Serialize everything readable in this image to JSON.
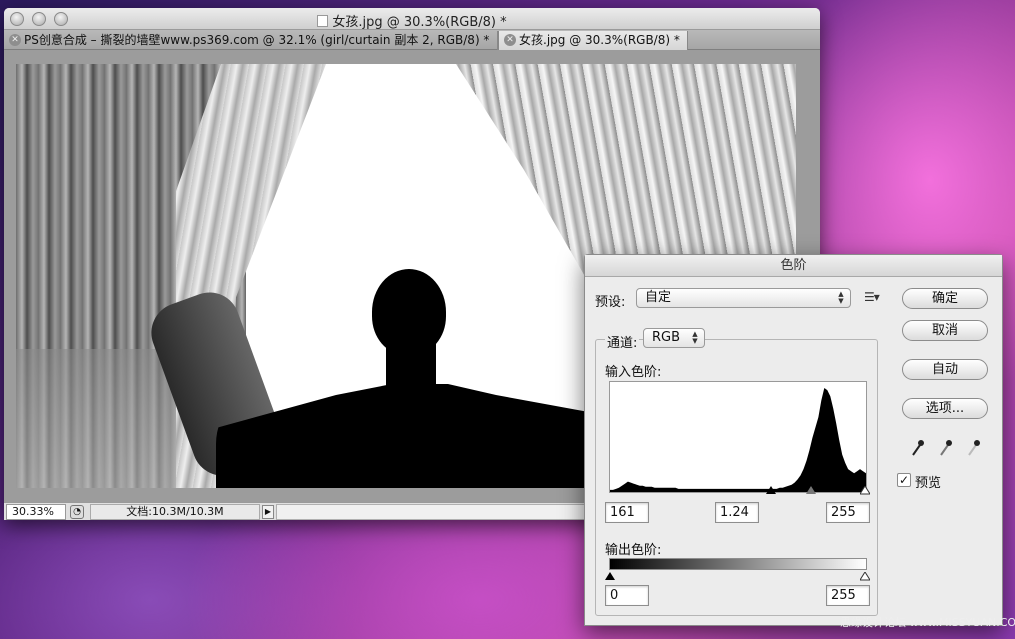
{
  "document_window": {
    "title": "女孩.jpg @ 30.3%(RGB/8) *",
    "tabs": [
      {
        "label": "PS创意合成 – 撕裂的墙壁www.ps369.com @ 32.1% (girl/curtain 副本 2, RGB/8) *",
        "active": false
      },
      {
        "label": "女孩.jpg @ 30.3%(RGB/8) *",
        "active": true
      }
    ],
    "status": {
      "zoom": "30.33%",
      "doc_size": "文档:10.3M/10.3M"
    }
  },
  "levels_dialog": {
    "title": "色阶",
    "preset_label": "预设:",
    "preset_value": "自定",
    "channel_label": "通道:",
    "channel_value": "RGB",
    "input_levels_label": "输入色阶:",
    "input_black": "161",
    "input_gamma": "1.24",
    "input_white": "255",
    "output_levels_label": "输出色阶:",
    "output_black": "0",
    "output_white": "255",
    "buttons": {
      "ok": "确定",
      "cancel": "取消",
      "auto": "自动",
      "options": "选项..."
    },
    "preview_label": "预览",
    "preview_checked": true,
    "histogram": [
      2,
      2,
      3,
      4,
      6,
      8,
      10,
      9,
      8,
      7,
      6,
      6,
      5,
      5,
      5,
      4,
      4,
      4,
      4,
      4,
      4,
      4,
      4,
      3,
      3,
      3,
      3,
      3,
      3,
      3,
      3,
      3,
      3,
      3,
      3,
      3,
      3,
      3,
      3,
      3,
      3,
      3,
      3,
      3,
      3,
      3,
      3,
      3,
      3,
      3,
      3,
      3,
      3,
      3,
      3,
      3,
      3,
      4,
      4,
      5,
      6,
      7,
      9,
      12,
      16,
      22,
      30,
      40,
      52,
      62,
      72,
      88,
      100,
      98,
      92,
      80,
      66,
      50,
      36,
      28,
      22,
      20,
      18,
      20,
      22,
      20,
      18
    ]
  },
  "watermark": "思缘设计论坛 www.MISSYUAN.COM"
}
